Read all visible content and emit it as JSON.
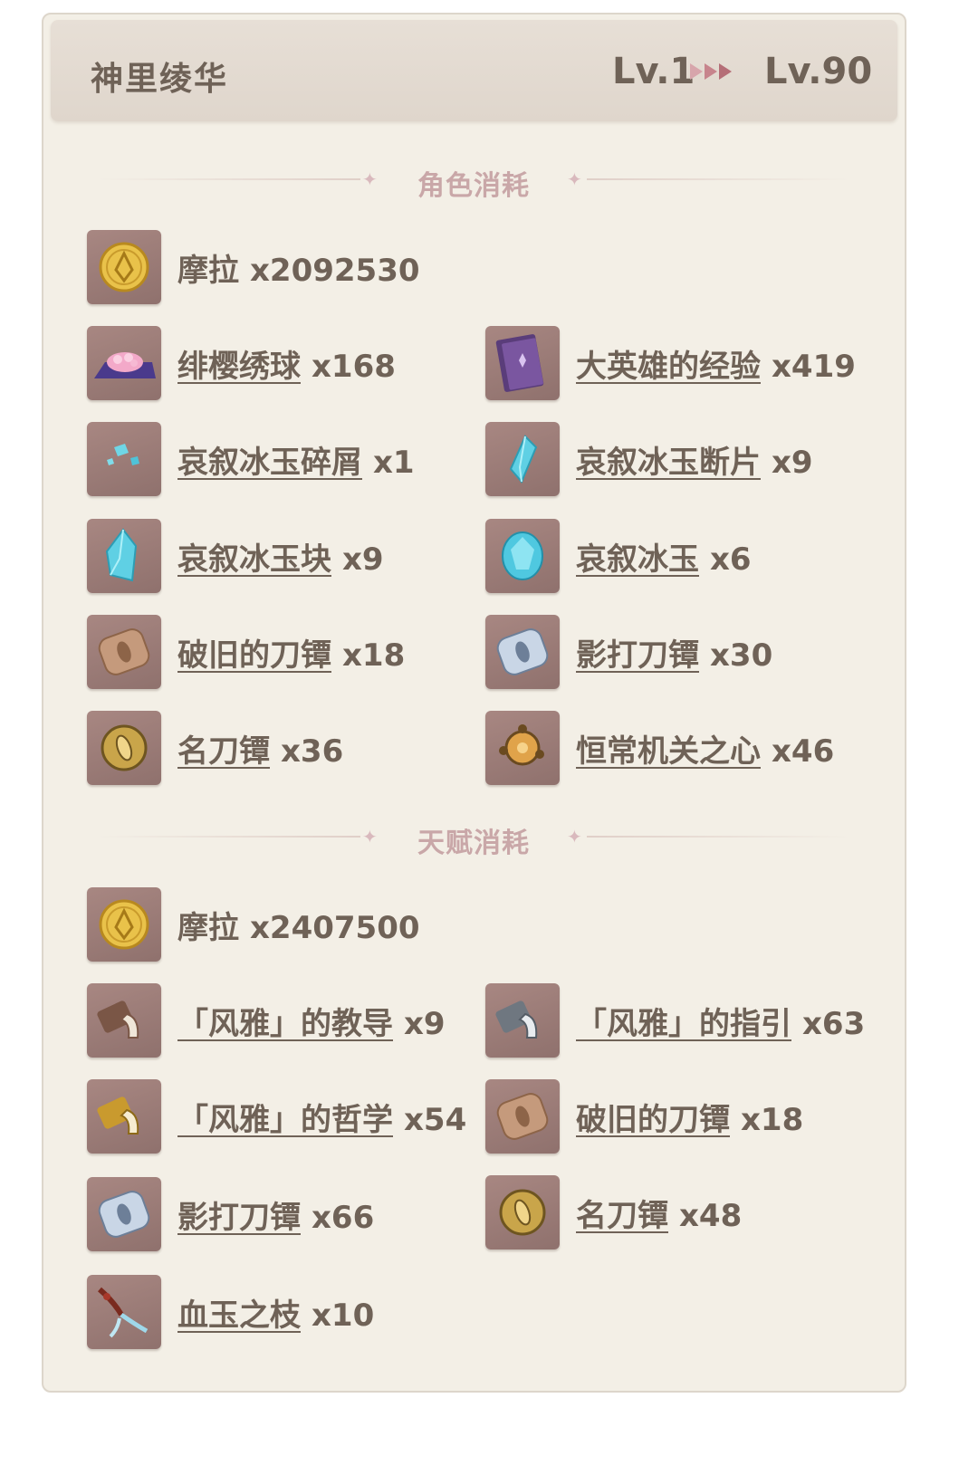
{
  "character": {
    "name": "神里绫华",
    "level_from": "Lv.1",
    "level_to": "Lv.90"
  },
  "sections": [
    {
      "title": "角色消耗",
      "items": [
        {
          "name": "摩拉",
          "qty": "x2092530",
          "icon": "mora-coin-icon",
          "link": false
        },
        {
          "name": "绯樱绣球",
          "qty": "x168",
          "icon": "sakura-bloom-icon",
          "link": true
        },
        {
          "name": "大英雄的经验",
          "qty": "x419",
          "icon": "heros-wit-book-icon",
          "link": true
        },
        {
          "name": "哀叙冰玉碎屑",
          "qty": "x1",
          "icon": "shivada-jade-sliver-icon",
          "link": true
        },
        {
          "name": "哀叙冰玉断片",
          "qty": "x9",
          "icon": "shivada-jade-fragment-icon",
          "link": true
        },
        {
          "name": "哀叙冰玉块",
          "qty": "x9",
          "icon": "shivada-jade-chunk-icon",
          "link": true
        },
        {
          "name": "哀叙冰玉",
          "qty": "x6",
          "icon": "shivada-jade-gemstone-icon",
          "link": true
        },
        {
          "name": "破旧的刀镡",
          "qty": "x18",
          "icon": "old-handguard-icon",
          "link": true
        },
        {
          "name": "影打刀镡",
          "qty": "x30",
          "icon": "kageuchi-handguard-icon",
          "link": true
        },
        {
          "name": "名刀镡",
          "qty": "x36",
          "icon": "famed-handguard-icon",
          "link": true
        },
        {
          "name": "恒常机关之心",
          "qty": "x46",
          "icon": "perpetual-heart-icon",
          "link": true
        }
      ]
    },
    {
      "title": "天赋消耗",
      "items": [
        {
          "name": "摩拉",
          "qty": "x2407500",
          "icon": "mora-coin-icon",
          "link": false
        },
        {
          "name": "「风雅」的教导",
          "qty": "x9",
          "icon": "teachings-of-elegance-icon",
          "link": true
        },
        {
          "name": "「风雅」的指引",
          "qty": "x63",
          "icon": "guide-to-elegance-icon",
          "link": true
        },
        {
          "name": "「风雅」的哲学",
          "qty": "x54",
          "icon": "philosophies-of-elegance-icon",
          "link": true
        },
        {
          "name": "破旧的刀镡",
          "qty": "x18",
          "icon": "old-handguard-icon",
          "link": true
        },
        {
          "name": "影打刀镡",
          "qty": "x66",
          "icon": "kageuchi-handguard-icon",
          "link": true
        },
        {
          "name": "名刀镡",
          "qty": "x48",
          "icon": "famed-handguard-icon",
          "link": true
        },
        {
          "name": "血玉之枝",
          "qty": "x10",
          "icon": "bloodjade-branch-icon",
          "link": true
        }
      ]
    }
  ],
  "colors": {
    "text": "#6f6257",
    "section_title": "#c9a7a8",
    "icon_bg": "#9a7b76",
    "card_bg": "#f3efe6",
    "header_bg": "#e3dbd1"
  }
}
